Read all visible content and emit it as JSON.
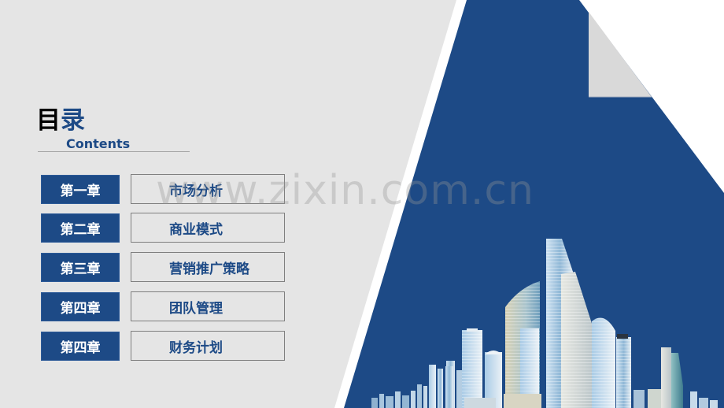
{
  "slide": {
    "title_cn_part1": "目",
    "title_cn_part2": "录",
    "title_en": "Contents",
    "watermark": "www.zixin.com.cn",
    "colors": {
      "brand_blue": "#1d4a86",
      "background_gray": "#e5e5e5",
      "accent_gray": "#d9d9d9",
      "outline_gray": "#7f7f7f"
    }
  },
  "toc": {
    "items": [
      {
        "chapter": "第一章",
        "topic": "市场分析"
      },
      {
        "chapter": "第二章",
        "topic": "商业模式"
      },
      {
        "chapter": "第三章",
        "topic": "营销推广策略"
      },
      {
        "chapter": "第四章",
        "topic": "团队管理"
      },
      {
        "chapter": "第四章",
        "topic": "财务计划"
      }
    ]
  },
  "decoration": {
    "skyline_image": "city-skyline-buildings"
  }
}
